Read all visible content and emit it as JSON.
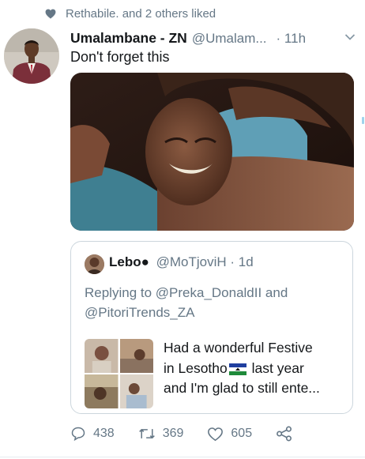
{
  "social_context": {
    "text": "Rethabile. and 2 others liked",
    "icon": "heart-icon"
  },
  "tweet": {
    "name": "Umalambane - ZN",
    "handle": "@Umalam...",
    "time": "· 11h",
    "text": "Don't forget this"
  },
  "quote": {
    "name": "Lebo●",
    "handle": "@MoTjoviH · 1d",
    "replying_line1": "Replying to @Preka_DonaldII and",
    "replying_line2": "@PitoriTrends_ZA",
    "text_line1": "Had a wonderful Festive",
    "text_line2_a": "in Lesotho",
    "text_line2_b": " last year",
    "text_line3": "and I'm glad to still ente..."
  },
  "actions": {
    "replies": "438",
    "retweets": "369",
    "likes": "605"
  },
  "colors": {
    "secondary_text": "#657786",
    "primary_text": "#14171a",
    "border": "#ccd6dd"
  }
}
